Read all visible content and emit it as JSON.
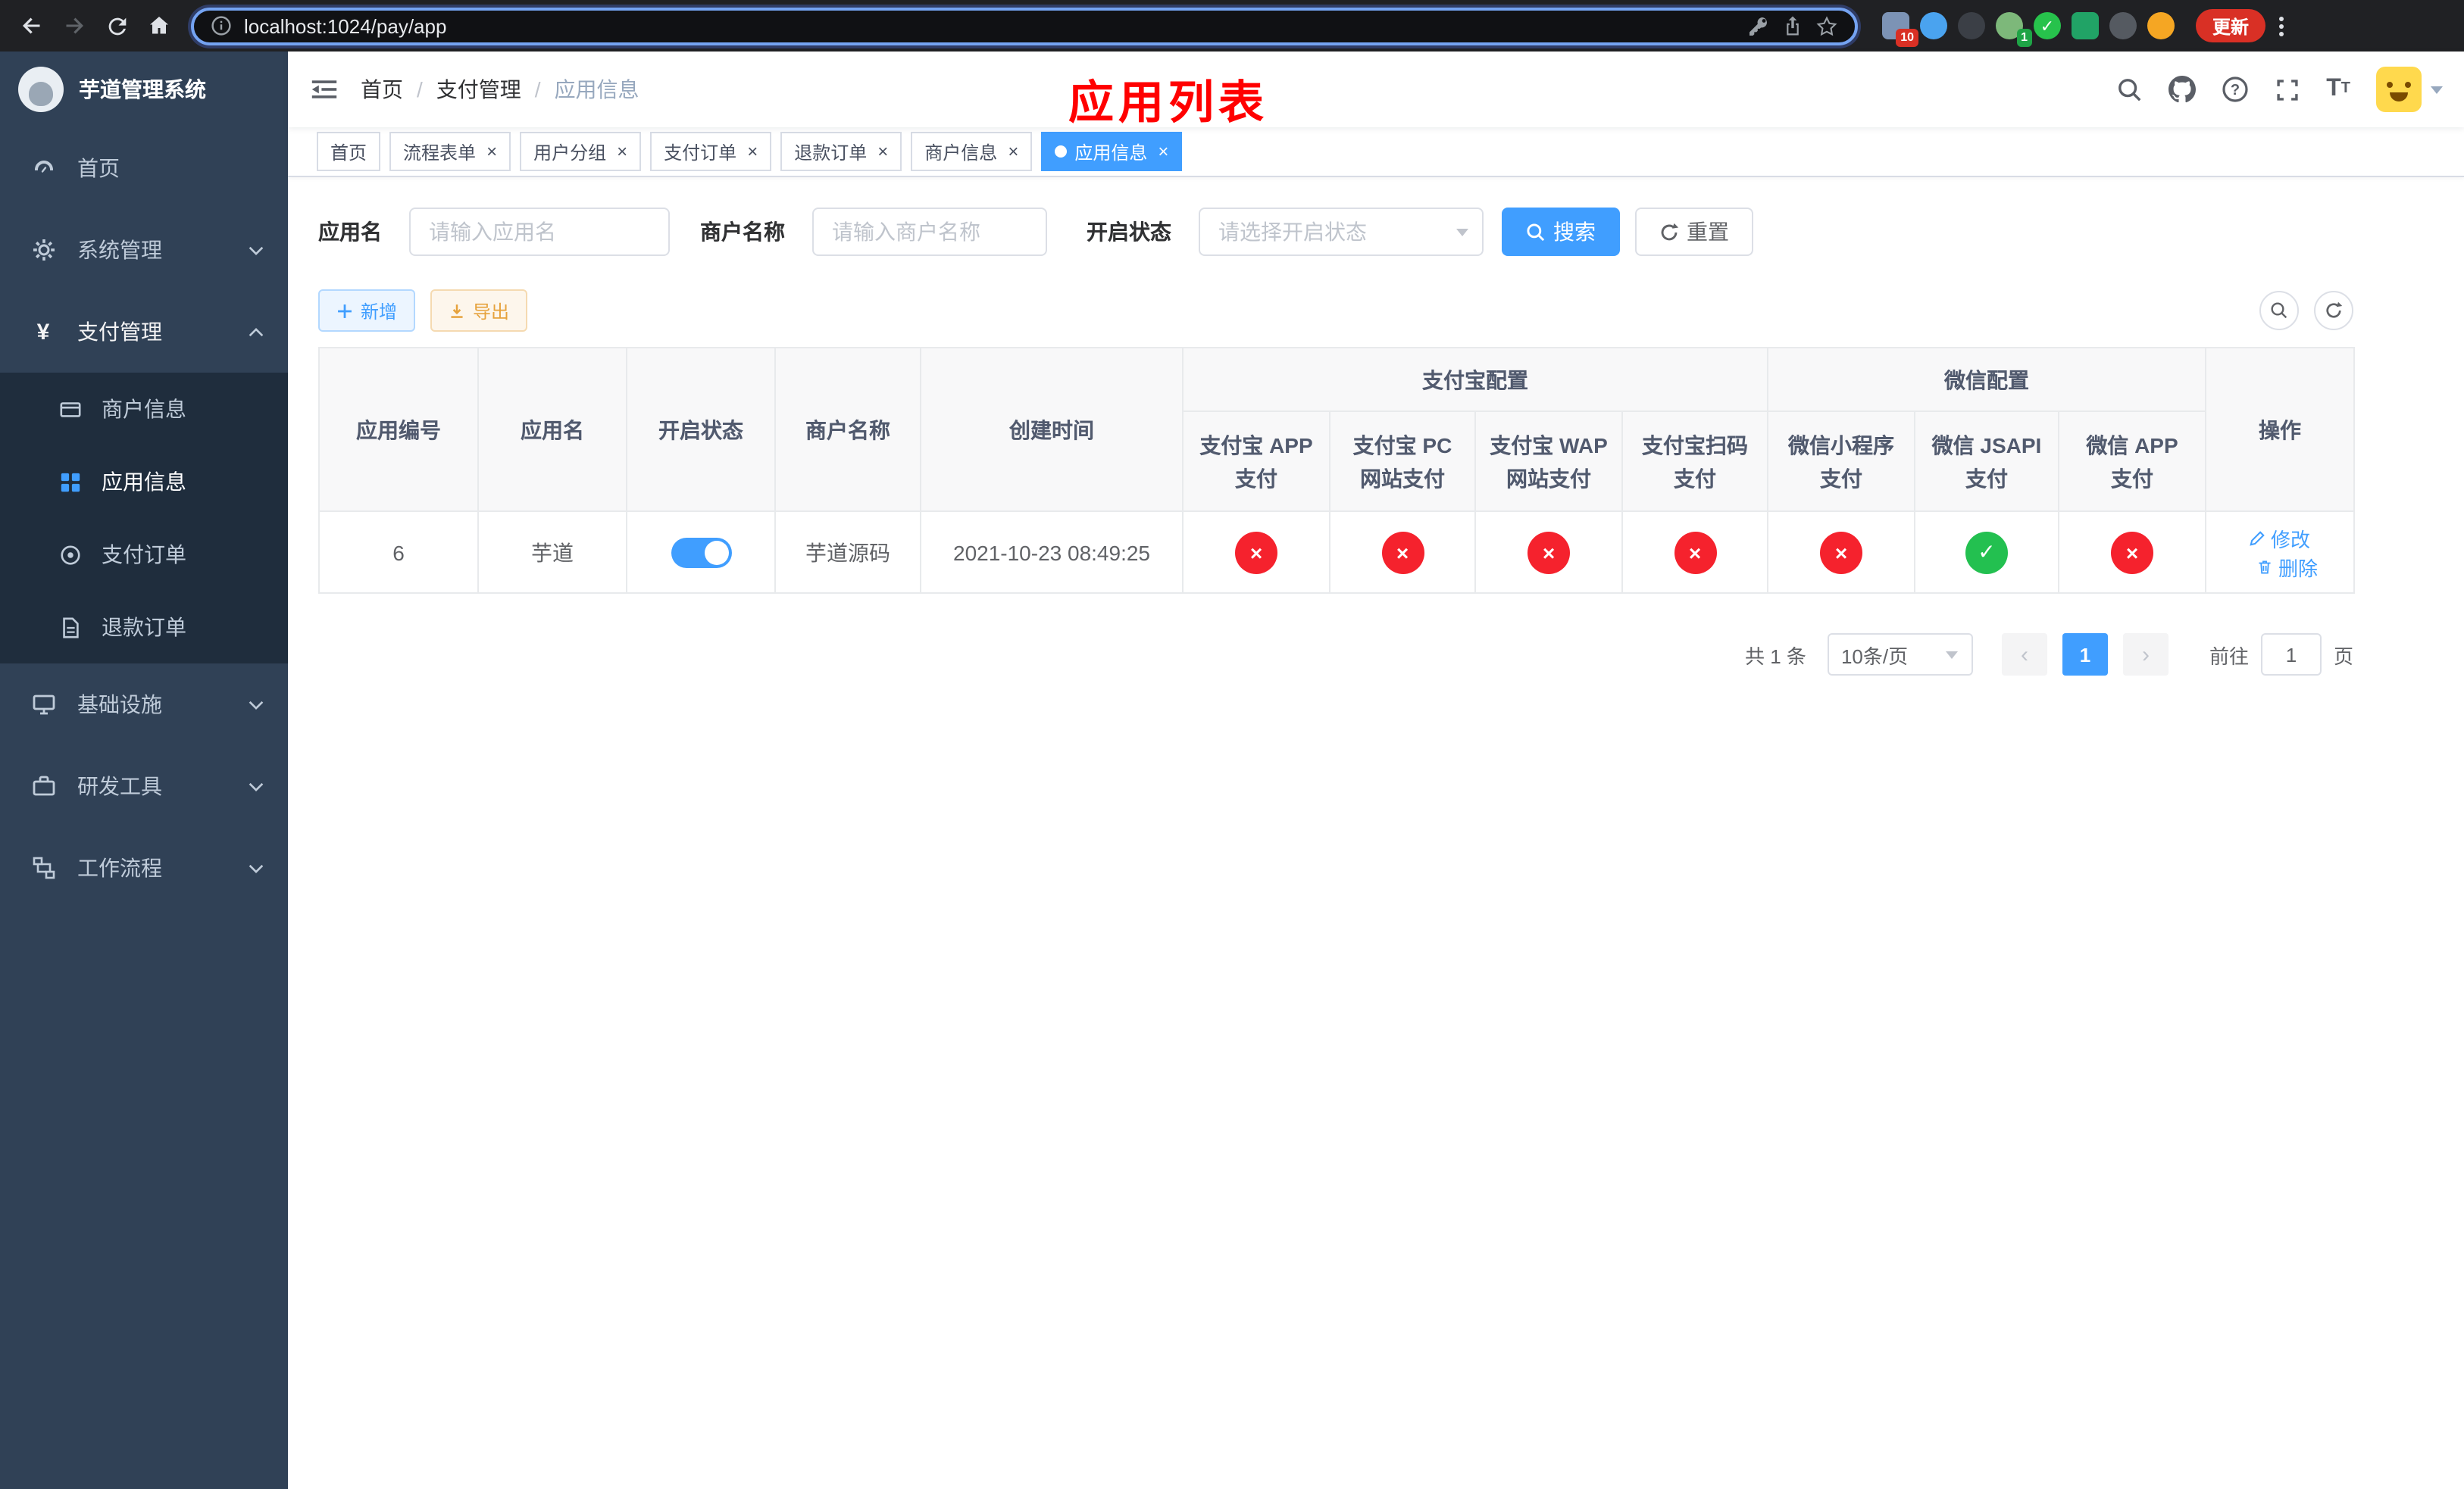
{
  "browser": {
    "url": "localhost:1024/pay/app",
    "update_label": "更新",
    "ext_badge_1": "10",
    "ext_badge_2": "1"
  },
  "sidebar": {
    "title": "芋道管理系统",
    "items": [
      {
        "label": "首页"
      },
      {
        "label": "系统管理"
      },
      {
        "label": "支付管理"
      },
      {
        "label": "基础设施"
      },
      {
        "label": "研发工具"
      },
      {
        "label": "工作流程"
      }
    ],
    "payment_children": [
      {
        "label": "商户信息"
      },
      {
        "label": "应用信息"
      },
      {
        "label": "支付订单"
      },
      {
        "label": "退款订单"
      }
    ]
  },
  "header": {
    "breadcrumb": [
      "首页",
      "支付管理",
      "应用信息"
    ],
    "separator": "/",
    "annotation": "应用列表"
  },
  "tabs": [
    {
      "label": "首页"
    },
    {
      "label": "流程表单"
    },
    {
      "label": "用户分组"
    },
    {
      "label": "支付订单"
    },
    {
      "label": "退款订单"
    },
    {
      "label": "商户信息"
    },
    {
      "label": "应用信息"
    }
  ],
  "filters": {
    "app_name_label": "应用名",
    "app_name_placeholder": "请输入应用名",
    "merchant_label": "商户名称",
    "merchant_placeholder": "请输入商户名称",
    "status_label": "开启状态",
    "status_placeholder": "请选择开启状态",
    "search_label": "搜索",
    "reset_label": "重置"
  },
  "toolbar": {
    "add_label": "新增",
    "export_label": "导出"
  },
  "table": {
    "cols": {
      "app_id": "应用编号",
      "app_name": "应用名",
      "status": "开启状态",
      "merchant_name": "商户名称",
      "create_time": "创建时间",
      "alipay_group": "支付宝配置",
      "wechat_group": "微信配置",
      "alipay_app": "支付宝 APP 支付",
      "alipay_pc": "支付宝 PC 网站支付",
      "alipay_wap": "支付宝 WAP 网站支付",
      "alipay_qr": "支付宝扫码支付",
      "wechat_mini": "微信小程序支付",
      "wechat_jsapi": "微信 JSAPI 支付",
      "wechat_app": "微信 APP 支付",
      "actions": "操作"
    },
    "row": {
      "app_id": "6",
      "app_name": "芋道",
      "status_on": true,
      "merchant_name": "芋道源码",
      "create_time": "2021-10-23 08:49:25",
      "configs": [
        "off",
        "off",
        "off",
        "off",
        "off",
        "on",
        "off"
      ],
      "edit_label": "修改",
      "delete_label": "删除"
    }
  },
  "pagination": {
    "total_label": "共 1 条",
    "page_size_label": "10条/页",
    "page": "1",
    "goto_label": "前往",
    "goto_value": "1",
    "unit_label": "页"
  },
  "colors": {
    "accent": "#409EFF",
    "danger": "#f5222d",
    "success": "#23c050",
    "sidebar_bg": "#304156",
    "annotation_red": "#ff0000"
  }
}
